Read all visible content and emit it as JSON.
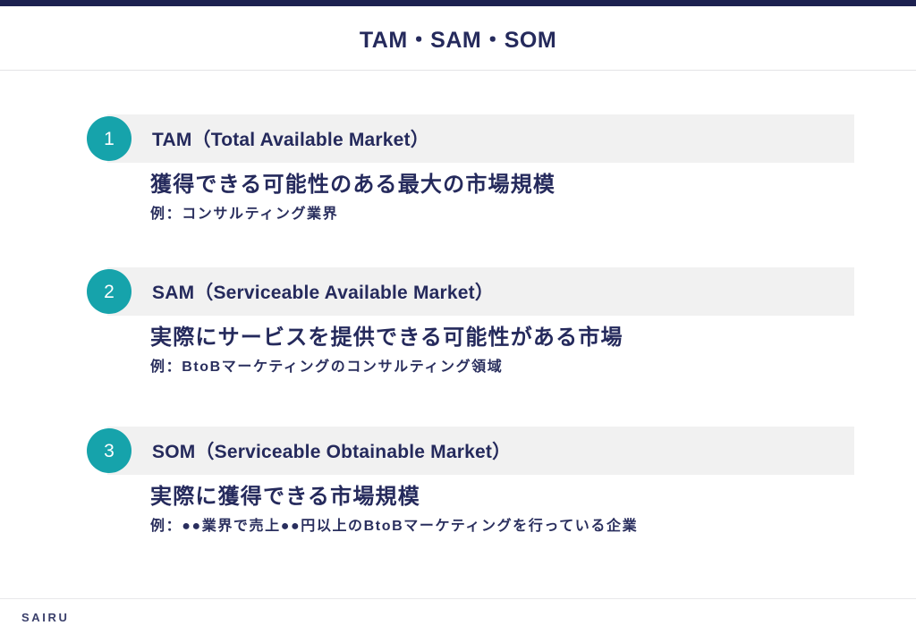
{
  "theme": {
    "accent_navy": "#1d2150",
    "text_navy": "#252a5c",
    "badge_teal": "#16a3ab",
    "band_gray": "#f1f1f1",
    "page_bg": "#ffffff"
  },
  "header": {
    "title": "TAM・SAM・SOM"
  },
  "sections": [
    {
      "number": "1",
      "title": "TAM（Total Available Market）",
      "description": "獲得できる可能性のある最大の市場規模",
      "example": "例：コンサルティング業界"
    },
    {
      "number": "2",
      "title": "SAM（Serviceable Available Market）",
      "description": "実際にサービスを提供できる可能性がある市場",
      "example": "例：BtoBマーケティングのコンサルティング領域"
    },
    {
      "number": "3",
      "title": "SOM（Serviceable Obtainable Market）",
      "description": "実際に獲得できる市場規模",
      "example": "例：●●業界で売上●●円以上のBtoBマーケティングを行っている企業"
    }
  ],
  "footer": {
    "logo": "SAIRU"
  }
}
